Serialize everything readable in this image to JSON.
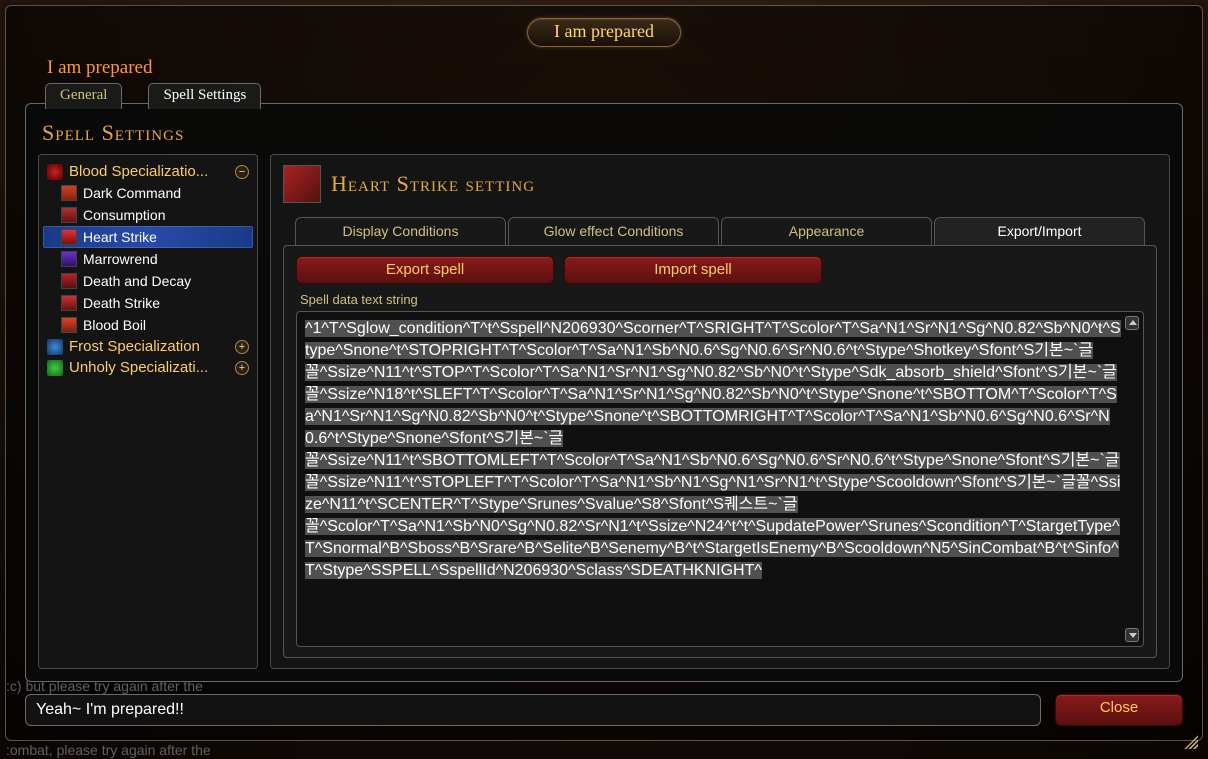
{
  "window_title": "I am prepared",
  "addon_title": "I am prepared",
  "outer_tabs": {
    "general": "General",
    "spell": "Spell Settings"
  },
  "panel_title": "Spell Settings",
  "specs": {
    "blood": {
      "label": "Blood Specializatio...",
      "expanded": true
    },
    "frost": {
      "label": "Frost Specialization",
      "expanded": false
    },
    "unholy": {
      "label": "Unholy Specializati...",
      "expanded": false
    }
  },
  "blood_spells": [
    "Dark Command",
    "Consumption",
    "Heart Strike",
    "Marrowrend",
    "Death and Decay",
    "Death Strike",
    "Blood Boil"
  ],
  "selected_spell": "Heart Strike",
  "main_title": "Heart Strike setting",
  "inner_tabs": {
    "display": "Display Conditions",
    "glow": "Glow effect Conditions",
    "appearance": "Appearance",
    "export": "Export/Import"
  },
  "buttons": {
    "export": "Export spell",
    "import": "Import spell",
    "close": "Close"
  },
  "field_label": "Spell data text string",
  "spell_string_segments": [
    "^1^T^Sglow_condition^T^t^Sspell^N206930^Scorner^T^SRIGHT^T^Scolor^T^Sa^N1^Sr^N1^Sg^N0.82^Sb^N0^t^Stype^Snone^t^STOPRIGHT^T^Scolor^T^Sa^N1^Sb^N0.6^Sg^N0.6^Sr^N0.6^t^Stype^Shotkey^Sfont^S기본~`글",
    "꼴^Ssize^N11^t^STOP^T^Scolor^T^Sa^N1^Sr^N1^Sg^N0.82^Sb^N0^t^Stype^Sdk_absorb_shield^Sfont^S기본~`글",
    "꼴^Ssize^N18^t^SLEFT^T^Scolor^T^Sa^N1^Sr^N1^Sg^N0.82^Sb^N0^t^Stype^Snone^t^SBOTTOM^T^Scolor^T^Sa^N1^Sr^N1^Sg^N0.82^Sb^N0^t^Stype^Snone^t^SBOTTOMRIGHT^T^Scolor^T^Sa^N1^Sb^N0.6^Sg^N0.6^Sr^N0.6^t^Stype^Snone^Sfont^S기본~`글",
    "꼴^Ssize^N11^t^SBOTTOMLEFT^T^Scolor^T^Sa^N1^Sb^N0.6^Sg^N0.6^Sr^N0.6^t^Stype^Snone^Sfont^S기본~`글",
    "꼴^Ssize^N11^t^STOPLEFT^T^Scolor^T^Sa^N1^Sb^N1^Sg^N1^Sr^N1^t^Stype^Scooldown^Sfont^S기본~`글꼴^Ssize^N11^t^SCENTER^T^Stype^Srunes^Svalue^S8^Sfont^S퀘스트~`글",
    "꼴^Scolor^T^Sa^N1^Sb^N0^Sg^N0.82^Sr^N1^t^Ssize^N24^t^t^SupdatePower^Srunes^Scondition^T^StargetType^T^Snormal^B^Sboss^B^Srare^B^Selite^B^Senemy^B^t^StargetIsEnemy^B^Scooldown^N5^SinCombat^B^t^Sinfo^T^Stype^SSPELL^SspellId^N206930^Sclass^SDEATHKNIGHT^"
  ],
  "chat_value": "Yeah~ I'm prepared!!",
  "bg_chat_top": ":c) but please try again after the",
  "bg_chat_bottom": ":ombat, please try again after the"
}
